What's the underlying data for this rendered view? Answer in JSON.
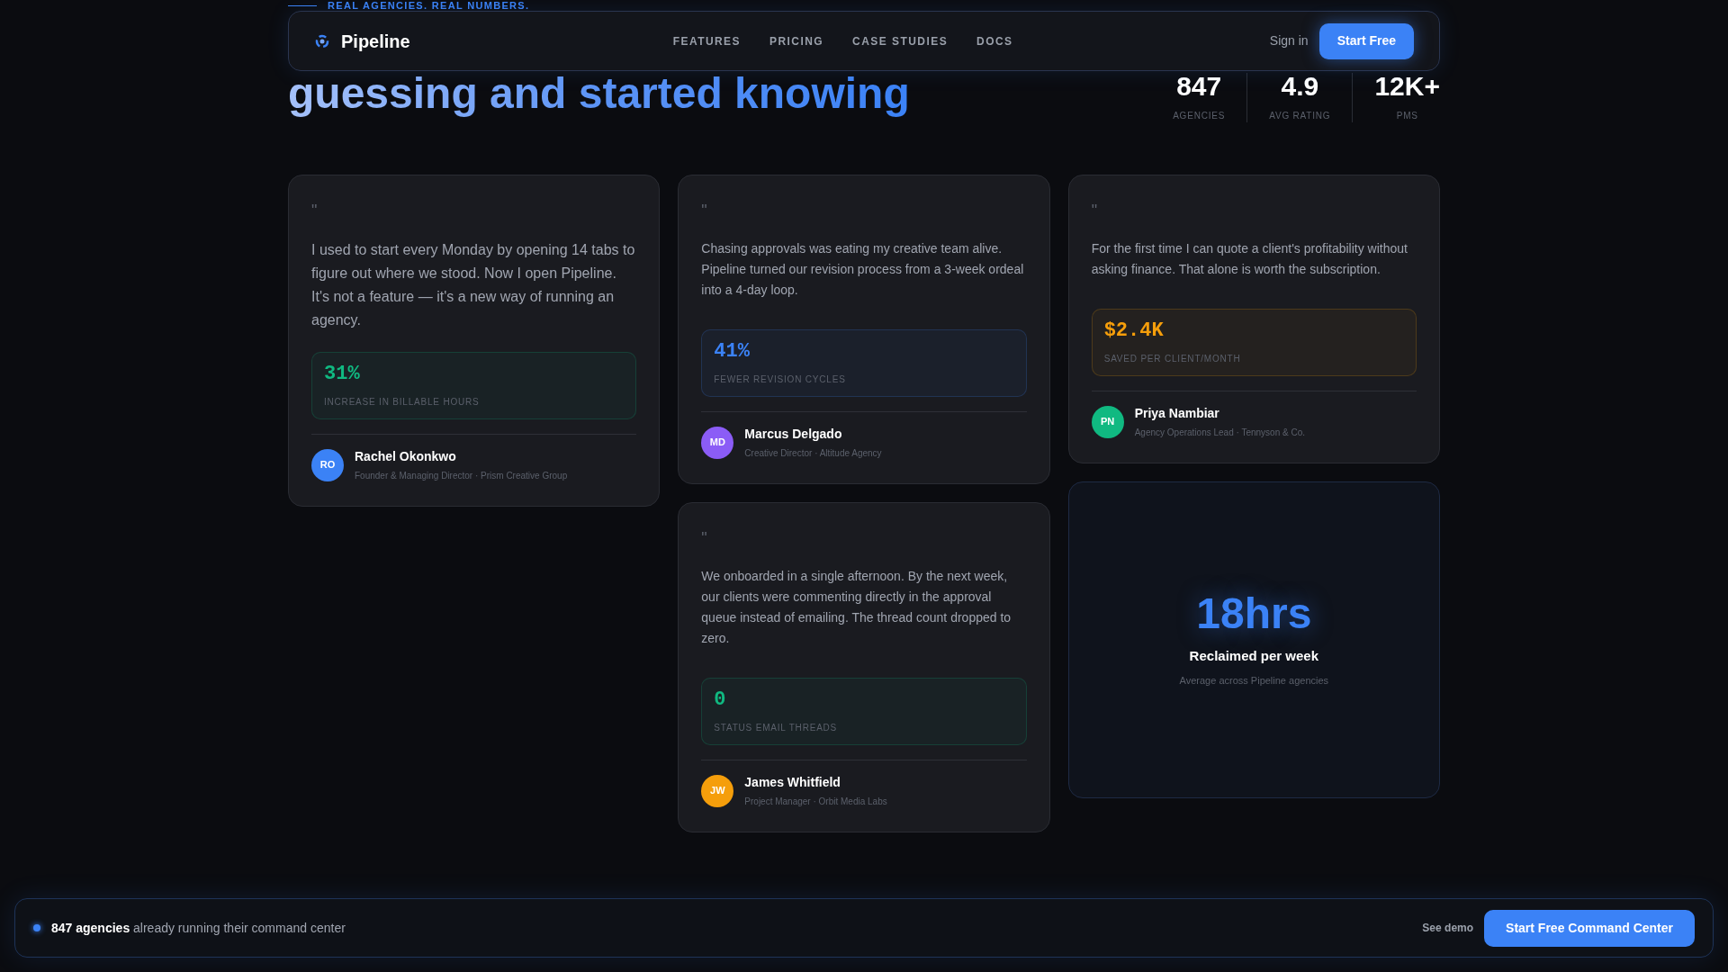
{
  "eyebrow": "REAL AGENCIES. REAL NUMBERS.",
  "nav": {
    "brand": "Pipeline",
    "links": [
      "FEATURES",
      "PRICING",
      "CASE STUDIES",
      "DOCS"
    ],
    "sign_in": "Sign in",
    "cta": "Start Free"
  },
  "heading": "guessing and started knowing",
  "stats": [
    {
      "value": "847",
      "label": "AGENCIES"
    },
    {
      "value": "4.9",
      "label": "AVG RATING"
    },
    {
      "value": "12K+",
      "label": "PMS"
    }
  ],
  "columns": [
    [
      {
        "kind": "featured",
        "quote_mark": "\"",
        "quote": "I used to start every Monday by opening 14 tabs to figure out where we stood. Now I open Pipeline. It's not a feature — it's a new way of running an agency.",
        "metric": {
          "value": "31%",
          "label": "INCREASE IN BILLABLE HOURS",
          "color": "#10b981"
        },
        "initials": "RO",
        "color": "#3b82f6",
        "name": "Rachel Okonkwo",
        "role": "Founder & Managing Director · Prism Creative Group"
      }
    ],
    [
      {
        "kind": "testimonial",
        "quote_mark": "\"",
        "quote": "Chasing approvals was eating my creative team alive. Pipeline turned our revision process from a 3-week ordeal into a 4-day loop.",
        "metric": {
          "value": "41%",
          "label": "FEWER REVISION CYCLES",
          "color": "#3b82f6"
        },
        "initials": "MD",
        "color": "#8b5cf6",
        "name": "Marcus Delgado",
        "role": "Creative Director · Altitude Agency"
      },
      {
        "kind": "testimonial",
        "quote_mark": "\"",
        "quote": "We onboarded in a single afternoon. By the next week, our clients were commenting directly in the approval queue instead of emailing. The thread count dropped to zero.",
        "metric": {
          "value": "0",
          "label": "STATUS EMAIL THREADS",
          "color": "#10b981"
        },
        "initials": "JW",
        "color": "#f59e0b",
        "name": "James Whitfield",
        "role": "Project Manager · Orbit Media Labs"
      }
    ],
    [
      {
        "kind": "testimonial",
        "quote_mark": "\"",
        "quote": "For the first time I can quote a client's profitability without asking finance. That alone is worth the subscription.",
        "metric": {
          "value": "$2.4K",
          "label": "SAVED PER CLIENT/MONTH",
          "color": "#f59e0b"
        },
        "initials": "PN",
        "color": "#10b981",
        "name": "Priya Nambiar",
        "role": "Agency Operations Lead · Tennyson & Co."
      },
      {
        "kind": "stat",
        "value": "18hrs",
        "title": "Reclaimed per week",
        "caption": "Average across Pipeline agencies"
      }
    ]
  ],
  "footer_bar": {
    "message": "**847 agencies** already running their command center",
    "secondary": "See demo",
    "cta": "Start Free Command Center"
  }
}
